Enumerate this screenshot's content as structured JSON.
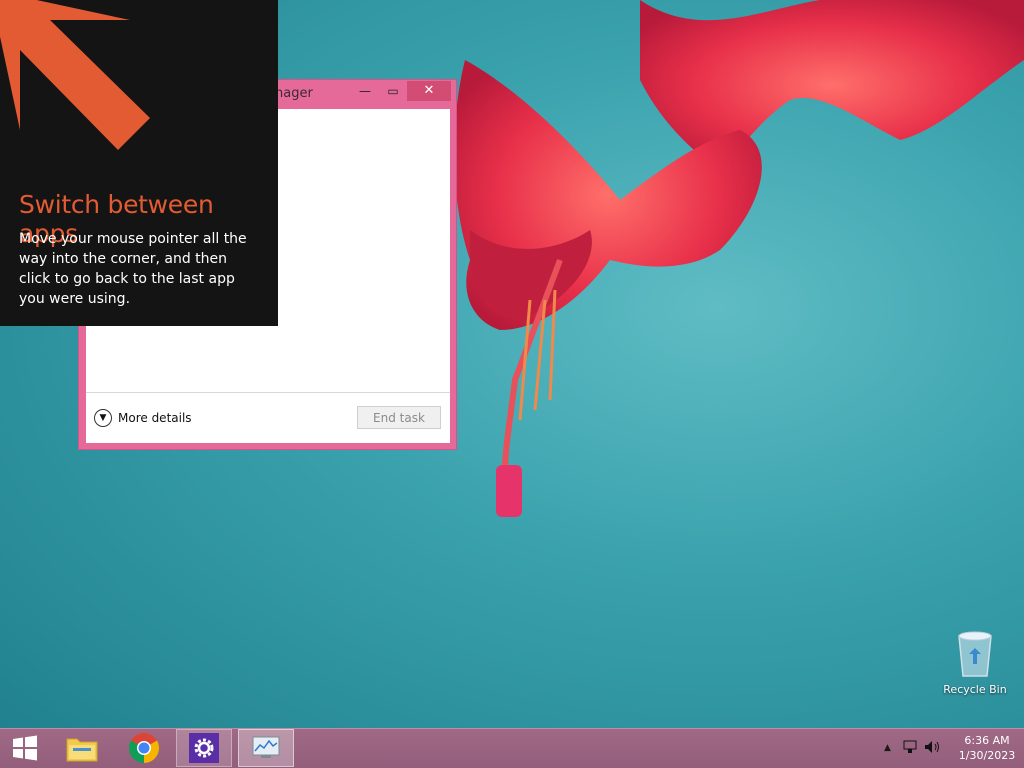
{
  "tip": {
    "title": "Switch between apps",
    "body": "Move your mouse pointer all the way into the corner, and then click to go back to the last app you were using.",
    "accent_color": "#e25b33"
  },
  "task_manager": {
    "title_fragment": "nager",
    "minimize_icon": "minimize-icon",
    "maximize_icon": "maximize-icon",
    "close_icon": "close-icon",
    "more_details_label": "More details",
    "end_task_label": "End task",
    "frame_color": "#e66a99"
  },
  "desktop": {
    "recycle_bin_label": "Recycle Bin"
  },
  "taskbar": {
    "items": [
      {
        "name": "start",
        "icon": "windows-logo-icon"
      },
      {
        "name": "file-explorer",
        "icon": "folder-icon"
      },
      {
        "name": "chrome",
        "icon": "chrome-icon"
      },
      {
        "name": "settings",
        "icon": "gear-icon"
      },
      {
        "name": "task-manager",
        "icon": "task-manager-icon"
      }
    ],
    "clock": {
      "time": "6:36 AM",
      "date": "1/30/2023"
    }
  }
}
